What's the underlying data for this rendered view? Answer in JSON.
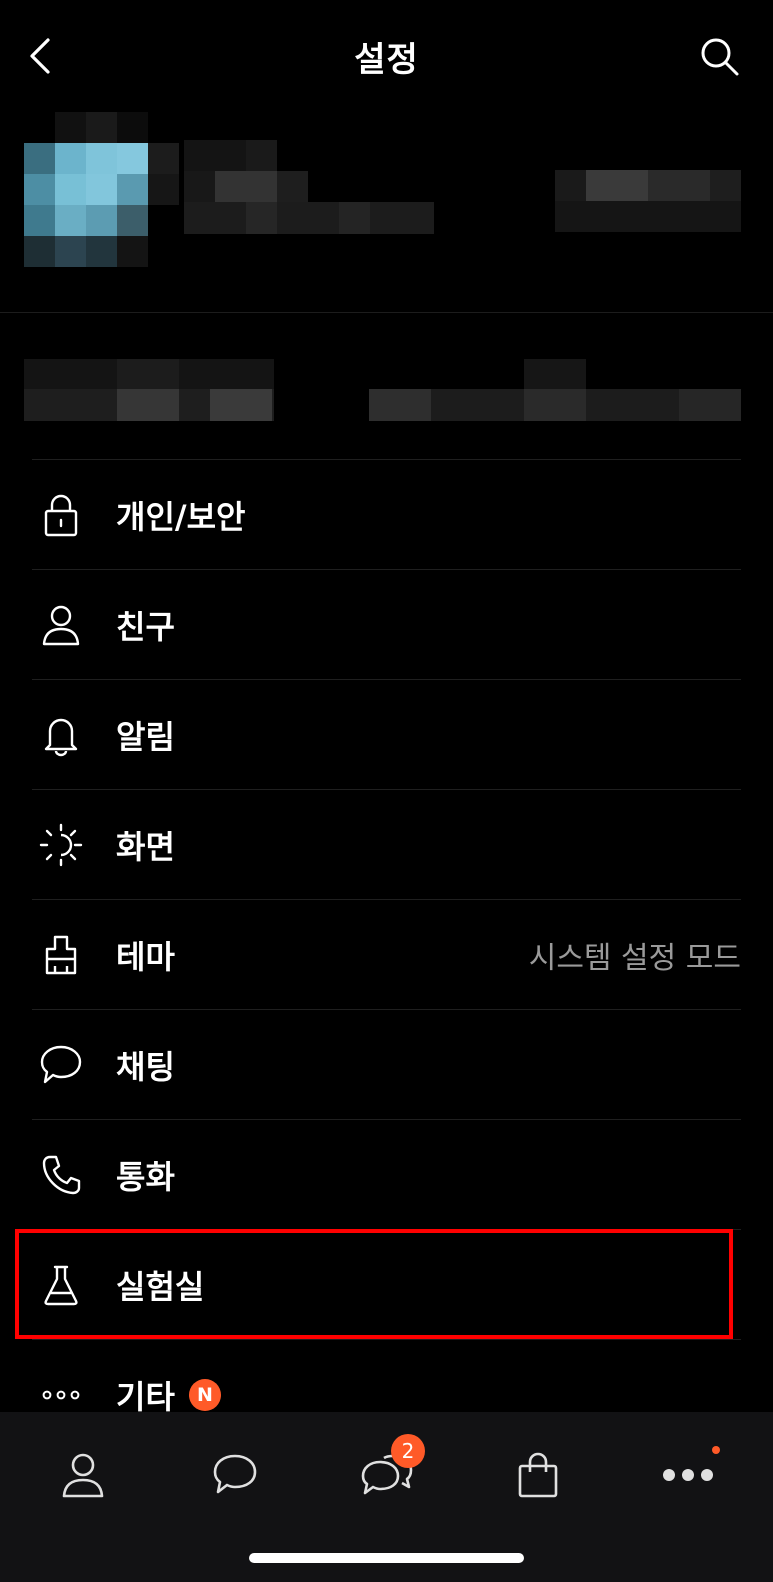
{
  "header": {
    "title": "설정",
    "back_icon": "chevron-left-icon",
    "search_icon": "search-icon"
  },
  "menu": {
    "items": [
      {
        "label": "개인/보안",
        "icon": "lock-icon"
      },
      {
        "label": "친구",
        "icon": "person-icon"
      },
      {
        "label": "알림",
        "icon": "bell-icon"
      },
      {
        "label": "화면",
        "icon": "brightness-icon"
      },
      {
        "label": "테마",
        "icon": "brush-icon",
        "value": "시스템 설정 모드"
      },
      {
        "label": "채팅",
        "icon": "chat-bubble-icon"
      },
      {
        "label": "통화",
        "icon": "phone-icon"
      },
      {
        "label": "실험실",
        "icon": "flask-icon"
      },
      {
        "label": "기타",
        "icon": "more-icon",
        "badge": "N"
      }
    ]
  },
  "tabbar": {
    "tabs": [
      {
        "name": "friends",
        "icon": "person-icon"
      },
      {
        "name": "chats",
        "icon": "chat-bubble-icon"
      },
      {
        "name": "openchat",
        "icon": "double-chat-icon",
        "badge": "2"
      },
      {
        "name": "shopping",
        "icon": "shopping-bag-icon"
      },
      {
        "name": "more",
        "icon": "more-dots-icon",
        "dot": true
      }
    ]
  },
  "colors": {
    "background": "#000000",
    "accent": "#ff5a28",
    "highlight": "#ff0000",
    "secondary_text": "#9a9a9a",
    "tabbar_bg": "#121214"
  }
}
